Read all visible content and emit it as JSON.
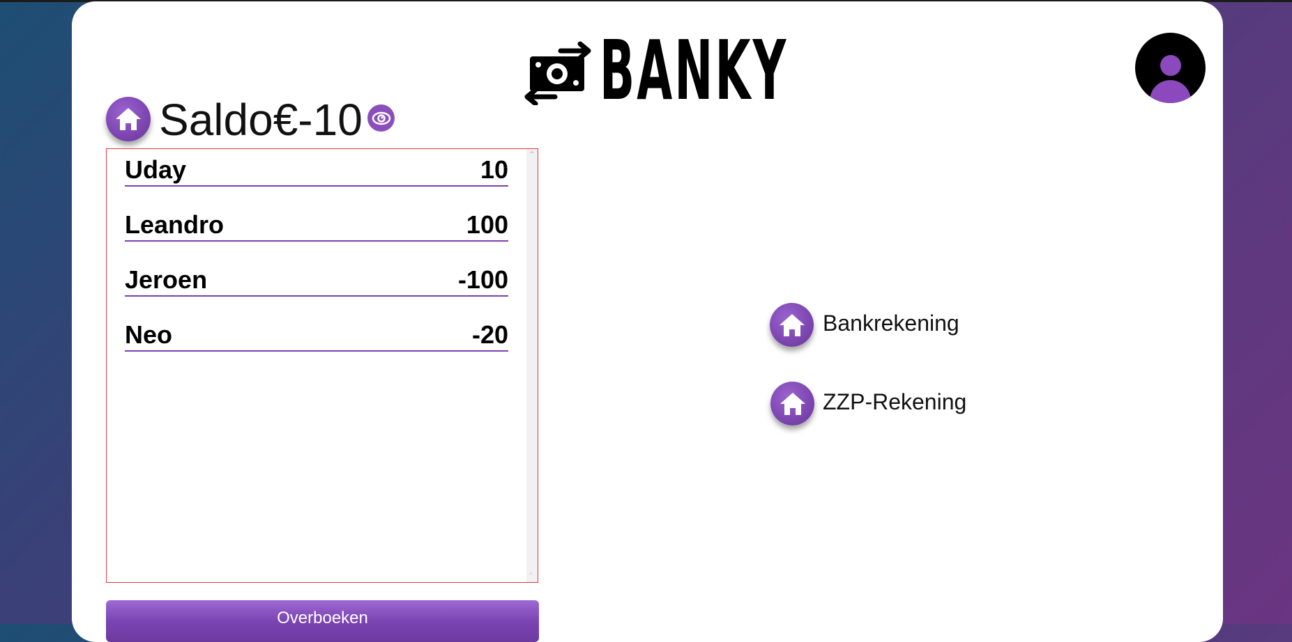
{
  "app": {
    "logo_text": "BANKY",
    "logo_icon": "money-transfer-icon",
    "avatar_icon": "user-avatar-icon"
  },
  "balance": {
    "home_icon": "home-icon",
    "label": "Saldo€-10",
    "toggle_icon": "eye-icon"
  },
  "transactions": [
    {
      "name": "Uday",
      "amount": "10"
    },
    {
      "name": "Leandro",
      "amount": "100"
    },
    {
      "name": "Jeroen",
      "amount": "-100"
    },
    {
      "name": "Neo",
      "amount": "-20"
    }
  ],
  "actions": {
    "transfer_label": "Overboeken"
  },
  "accounts": [
    {
      "label": "Bankrekening",
      "icon": "home-icon"
    },
    {
      "label": "ZZP-Rekening",
      "icon": "home-icon"
    }
  ],
  "colors": {
    "accent": "#7c45b0",
    "list_border": "#e0343e"
  }
}
